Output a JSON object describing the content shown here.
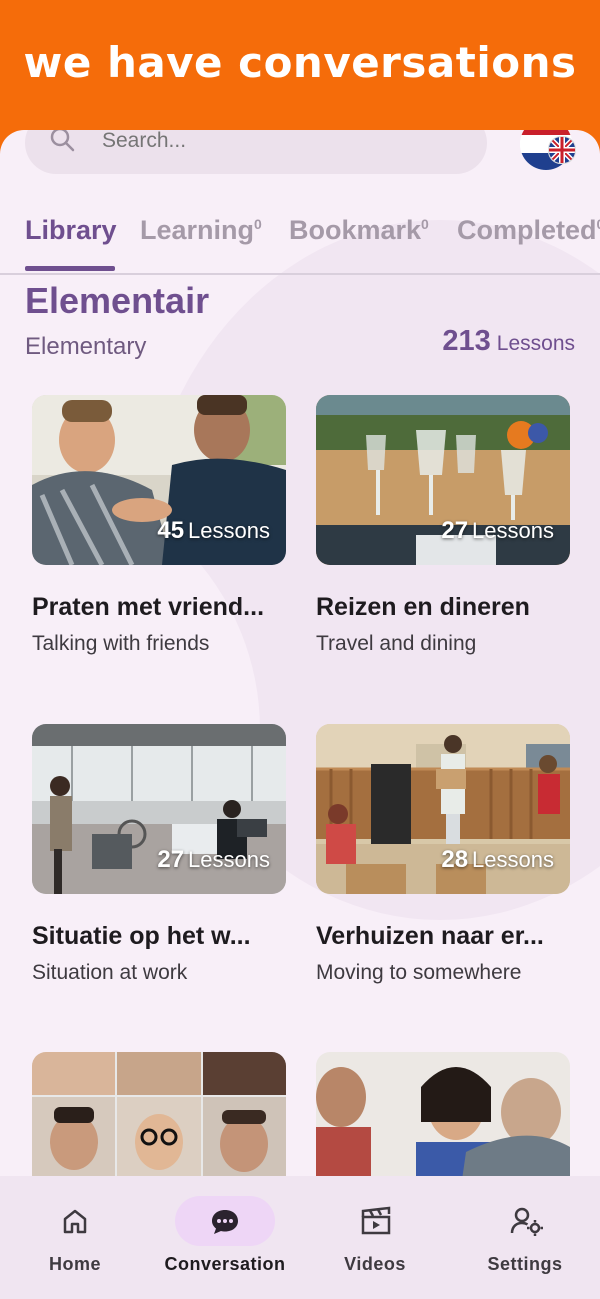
{
  "banner": {
    "text": "we have conversations"
  },
  "search": {
    "placeholder": "Search..."
  },
  "tabs": [
    {
      "label": "Library",
      "count": ""
    },
    {
      "label": "Learning",
      "count": "0"
    },
    {
      "label": "Bookmark",
      "count": "0"
    },
    {
      "label": "Completed",
      "count": "0"
    }
  ],
  "level": {
    "title": "Elementair",
    "subtitle": "Elementary",
    "lesson_count": "213",
    "lesson_word": "Lessons"
  },
  "cards": [
    {
      "title": "Praten met vriend...",
      "subtitle": "Talking with friends",
      "lessons": "45",
      "lessons_word": "Lessons",
      "image": "two-men-talking-photo"
    },
    {
      "title": "Reizen en dineren",
      "subtitle": "Travel and dining",
      "lessons": "27",
      "lessons_word": "Lessons",
      "image": "dining-table-glasses-photo"
    },
    {
      "title": "Situatie op het w...",
      "subtitle": "Situation at work",
      "lessons": "27",
      "lessons_word": "Lessons",
      "image": "office-workers-photo"
    },
    {
      "title": "Verhuizen naar er...",
      "subtitle": "Moving to somewhere",
      "lessons": "28",
      "lessons_word": "Lessons",
      "image": "family-moving-boxes-photo"
    },
    {
      "title": "",
      "subtitle": "",
      "lessons": "",
      "lessons_word": "",
      "image": "faces-collage-photo"
    },
    {
      "title": "",
      "subtitle": "",
      "lessons": "",
      "lessons_word": "",
      "image": "people-conversation-photo"
    }
  ],
  "nav": [
    {
      "label": "Home",
      "icon": "home-icon"
    },
    {
      "label": "Conversation",
      "icon": "chat-bubble-icon"
    },
    {
      "label": "Videos",
      "icon": "clapperboard-icon"
    },
    {
      "label": "Settings",
      "icon": "user-gear-icon"
    }
  ],
  "colors": {
    "banner": "#f56c0a",
    "accent": "#6f4f8f",
    "background": "#f8eff8",
    "nav_active": "#eed6f6"
  }
}
